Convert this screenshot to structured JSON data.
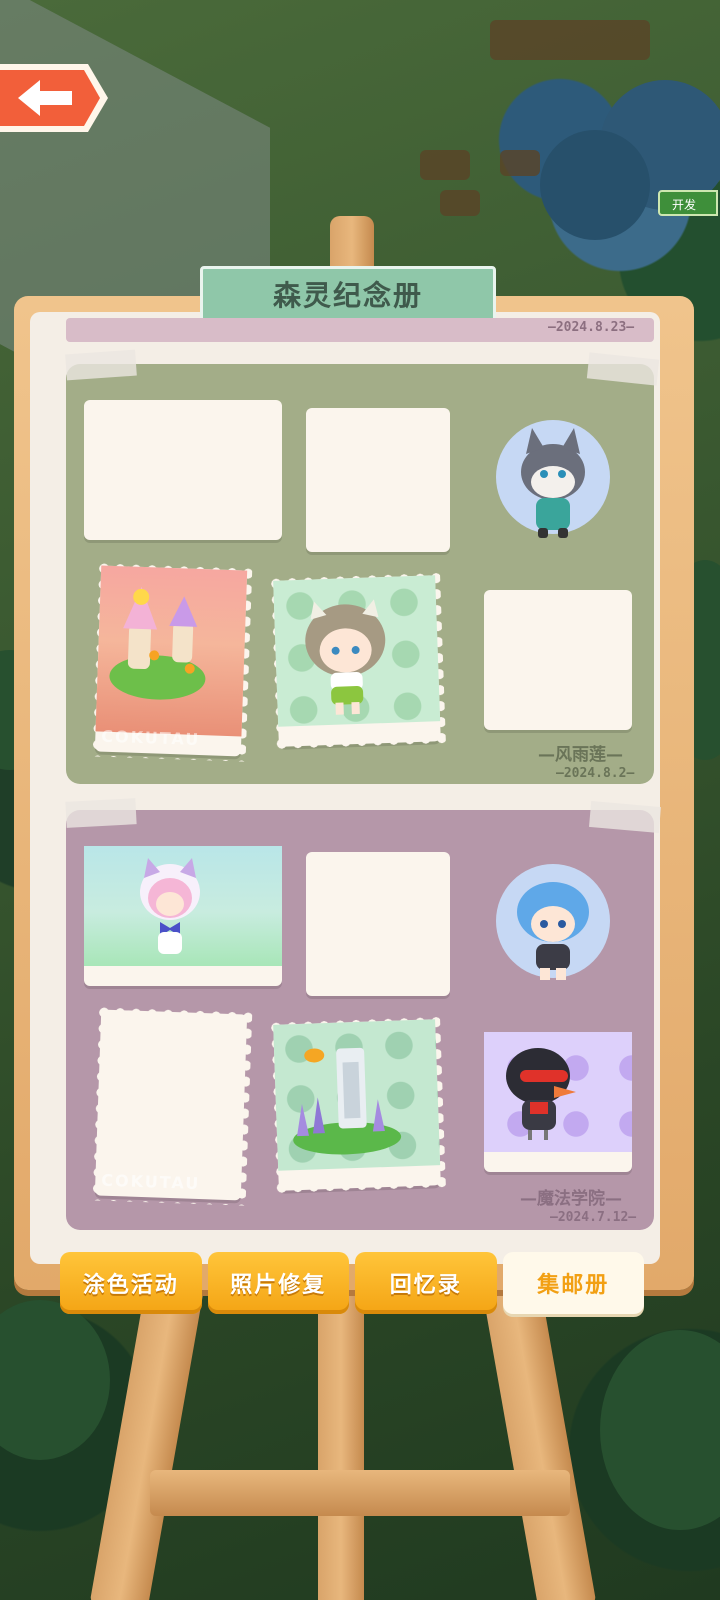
{
  "title": "森灵纪念册",
  "side_tag": "开发",
  "header_date": "—2024.8.23—",
  "albums": [
    {
      "name": "—风雨莲—",
      "date": "—2024.8.2—",
      "name_color": "#6a7458"
    },
    {
      "name": "—魔法学院—",
      "date": "—2024.7.12—",
      "name_color": "#8b6f82"
    }
  ],
  "stamp_text": "COKUTAU",
  "tabs": [
    {
      "label": "涂色活动",
      "active": false
    },
    {
      "label": "照片修复",
      "active": false
    },
    {
      "label": "回忆录",
      "active": false
    },
    {
      "label": "集邮册",
      "active": true
    }
  ],
  "colors": {
    "accent": "#f4a414",
    "tab_active_text": "#f2a014",
    "title_bg": "#8fc7a9"
  }
}
